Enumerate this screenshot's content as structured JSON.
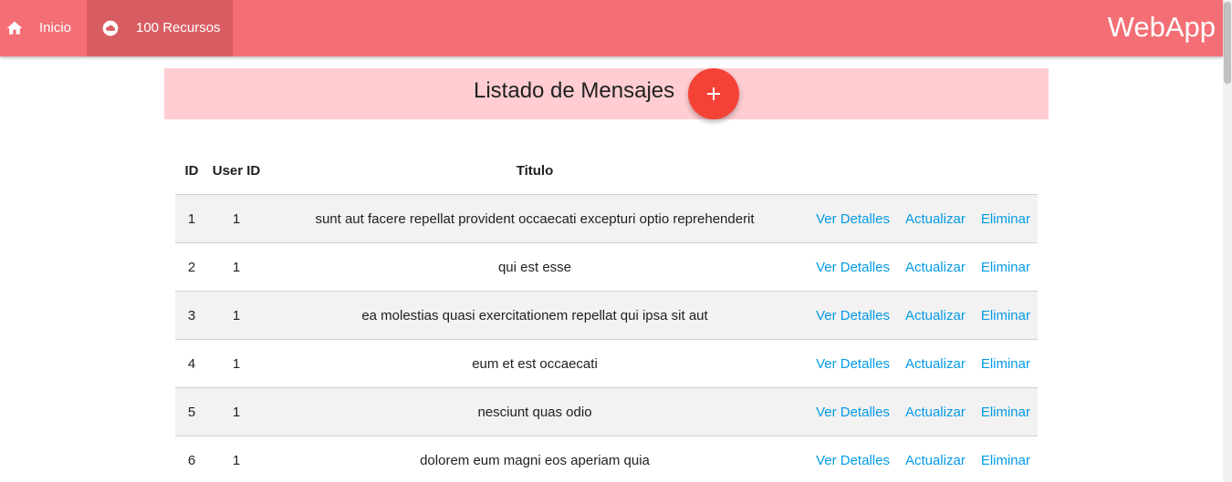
{
  "navbar": {
    "items": [
      {
        "label": "Inicio",
        "icon": "home-icon"
      },
      {
        "label": "100 Recursos",
        "icon": "cloud-icon"
      }
    ],
    "brand": "WebApp",
    "color": "#f36f75",
    "active_color": "#d85d63"
  },
  "header": {
    "title": "Listado de Mensajes",
    "add_button_icon": "plus-icon",
    "band_color": "#ffcdd2",
    "fab_color": "#f44336"
  },
  "table": {
    "columns": [
      "ID",
      "User ID",
      "Titulo",
      ""
    ],
    "actions": [
      "Ver Detalles",
      "Actualizar",
      "Eliminar"
    ],
    "link_color": "#039be5",
    "rows": [
      {
        "id": "1",
        "user_id": "1",
        "title": "sunt aut facere repellat provident occaecati excepturi optio reprehenderit"
      },
      {
        "id": "2",
        "user_id": "1",
        "title": "qui est esse"
      },
      {
        "id": "3",
        "user_id": "1",
        "title": "ea molestias quasi exercitationem repellat qui ipsa sit aut"
      },
      {
        "id": "4",
        "user_id": "1",
        "title": "eum et est occaecati"
      },
      {
        "id": "5",
        "user_id": "1",
        "title": "nesciunt quas odio"
      },
      {
        "id": "6",
        "user_id": "1",
        "title": "dolorem eum magni eos aperiam quia"
      }
    ]
  }
}
